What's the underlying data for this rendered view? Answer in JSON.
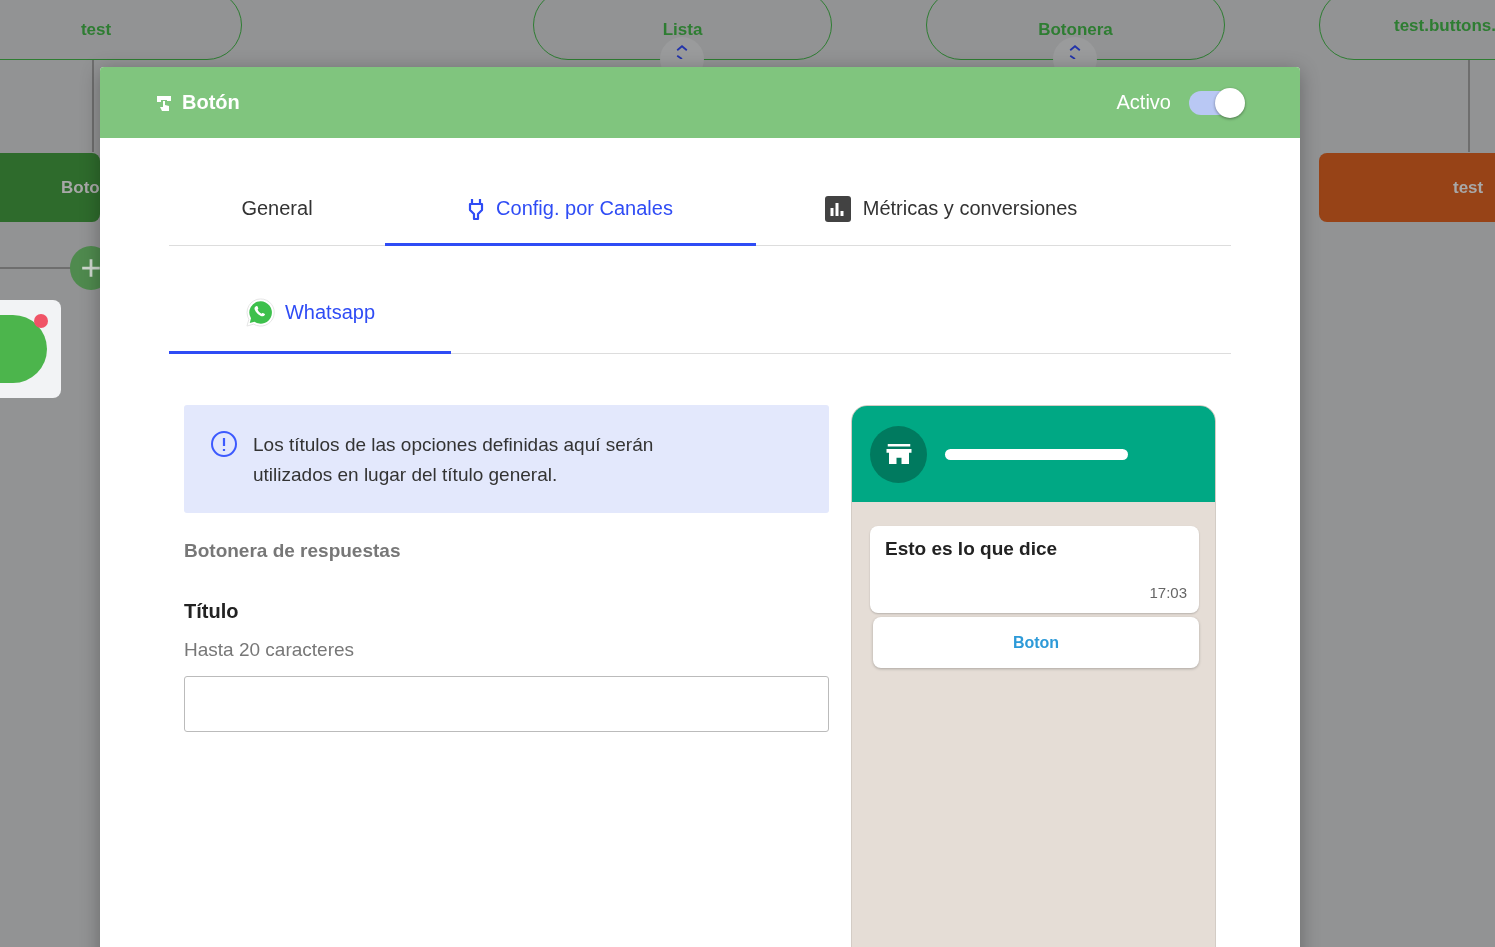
{
  "canvas": {
    "nodes": [
      {
        "kind": "pill",
        "label": "test"
      },
      {
        "kind": "expandable",
        "label": "Lista"
      },
      {
        "kind": "expandable",
        "label": "Botonera"
      },
      {
        "kind": "pill",
        "label": "test.buttons."
      },
      {
        "kind": "block",
        "label": "Boto",
        "color": "#2e6b2c"
      },
      {
        "kind": "block",
        "label": "test",
        "color": "#974317"
      }
    ]
  },
  "dialog": {
    "title": "Botón",
    "toggle": {
      "label": "Activo",
      "on": true
    },
    "tabs": [
      {
        "label": "General",
        "kind": "plain",
        "selected": false
      },
      {
        "label": "Config. por Canales",
        "kind": "plug",
        "selected": true
      },
      {
        "label": "Métricas y conversiones",
        "kind": "chart",
        "selected": false
      }
    ],
    "channel_tabs": [
      {
        "label": "Whatsapp",
        "selected": true
      }
    ],
    "info": "Los títulos de las opciones definidas aquí serán utilizados en lugar del título general.",
    "section": "Botonera de respuestas",
    "field": {
      "label": "Título",
      "hint": "Hasta 20 caracteres"
    },
    "preview": {
      "message": "Esto es lo que dice",
      "time": "17:03",
      "buttons": [
        "Boton"
      ]
    }
  }
}
